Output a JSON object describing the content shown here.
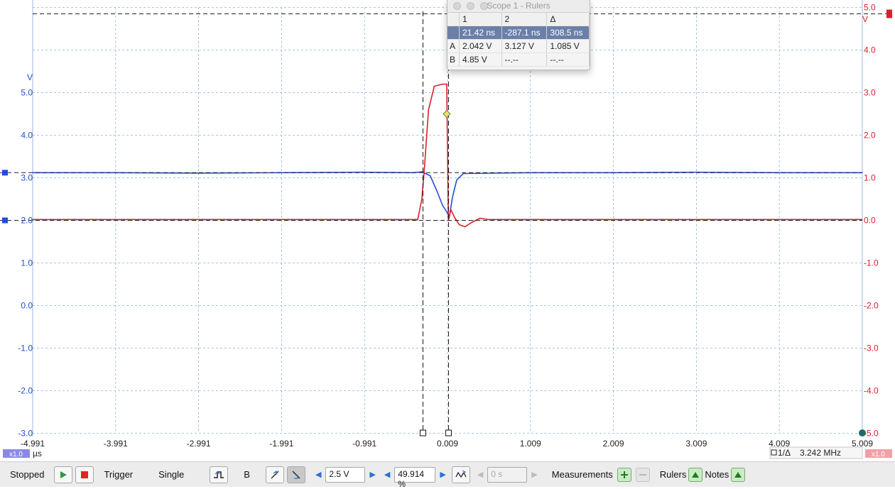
{
  "scope": {
    "x_ticks": [
      "-4.991",
      "-3.991",
      "-2.991",
      "-1.991",
      "-0.991",
      "0.009",
      "1.009",
      "2.009",
      "3.009",
      "4.009",
      "5.009"
    ],
    "left_ticks": [
      "5.0",
      "4.0",
      "3.0",
      "2.0",
      "1.0",
      "0.0",
      "-1.0",
      "-2.0",
      "-3.0"
    ],
    "right_ticks": [
      "5.0",
      "4.0",
      "3.0",
      "2.0",
      "1.0",
      "0.0",
      "-1.0",
      "-2.0",
      "-3.0",
      "-4.0",
      "-5.0"
    ],
    "left_unit": "V",
    "right_unit": "V",
    "x_unit": "µs",
    "left_scale_badge": "x1.0",
    "right_scale_badge": "x1.0",
    "cursor_readout_label": "1/Δ",
    "cursor_readout_value": "3.242 MHz",
    "colors": {
      "channel_a": "#1f4fd6",
      "channel_b": "#d9202e",
      "grid": "#8fb3d6"
    }
  },
  "chart_data": {
    "type": "line",
    "xlabel": "µs",
    "xlim": [
      -4.991,
      5.009
    ],
    "series": [
      {
        "axis": "left",
        "ylim": [
          -3.0,
          5.8
        ],
        "x": [
          -4.991,
          -4.0,
          -3.0,
          -2.0,
          -1.0,
          -0.4,
          -0.3,
          -0.2,
          -0.12,
          -0.05,
          0.0,
          0.03,
          0.07,
          0.12,
          0.2,
          1.0,
          2.0,
          3.0,
          4.0,
          5.009
        ],
        "y": [
          3.12,
          3.12,
          3.11,
          3.12,
          3.13,
          3.12,
          3.14,
          3.05,
          2.7,
          2.35,
          2.2,
          2.08,
          2.55,
          2.95,
          3.1,
          3.12,
          3.12,
          3.13,
          3.12,
          3.12
        ]
      },
      {
        "axis": "right",
        "ylim": [
          -5.0,
          5.0
        ],
        "x": [
          -4.991,
          -4.0,
          -3.0,
          -2.0,
          -1.0,
          -0.35,
          -0.3,
          -0.27,
          -0.22,
          -0.15,
          -0.05,
          0.0,
          0.01,
          0.02,
          0.05,
          0.1,
          0.15,
          0.22,
          0.3,
          0.4,
          0.5,
          1.0,
          2.0,
          3.0,
          4.0,
          5.009
        ],
        "y": [
          0.02,
          0.02,
          0.02,
          0.02,
          0.02,
          0.02,
          0.5,
          1.2,
          2.6,
          3.15,
          3.2,
          3.2,
          1.5,
          0.0,
          0.25,
          0.05,
          -0.1,
          -0.15,
          -0.05,
          0.05,
          0.02,
          0.02,
          0.02,
          0.02,
          0.02,
          0.02
        ]
      }
    ],
    "cursors_x": [
      -0.287,
      0.0214
    ],
    "threshold_left": 3.12,
    "threshold_right": 0.0,
    "top_marker_right": 4.85
  },
  "rulers": {
    "title": "Scope 1 - Rulers",
    "headers": [
      "",
      "1",
      "2",
      "Δ"
    ],
    "rows": [
      [
        "",
        "21.42 ns",
        "-287.1 ns",
        "308.5 ns"
      ],
      [
        "A",
        "2.042 V",
        "3.127 V",
        "1.085 V"
      ],
      [
        "B",
        "4.85 V",
        "--.--",
        "--.--"
      ]
    ]
  },
  "toolbar": {
    "status": "Stopped",
    "trigger_label": "Trigger",
    "mode_label": "Single",
    "source_label": "B",
    "level_value": "2.5 V",
    "position_value": "49.914 %",
    "holdoff_value": "0 s",
    "measurements_label": "Measurements",
    "rulers_label": "Rulers",
    "notes_label": "Notes"
  }
}
